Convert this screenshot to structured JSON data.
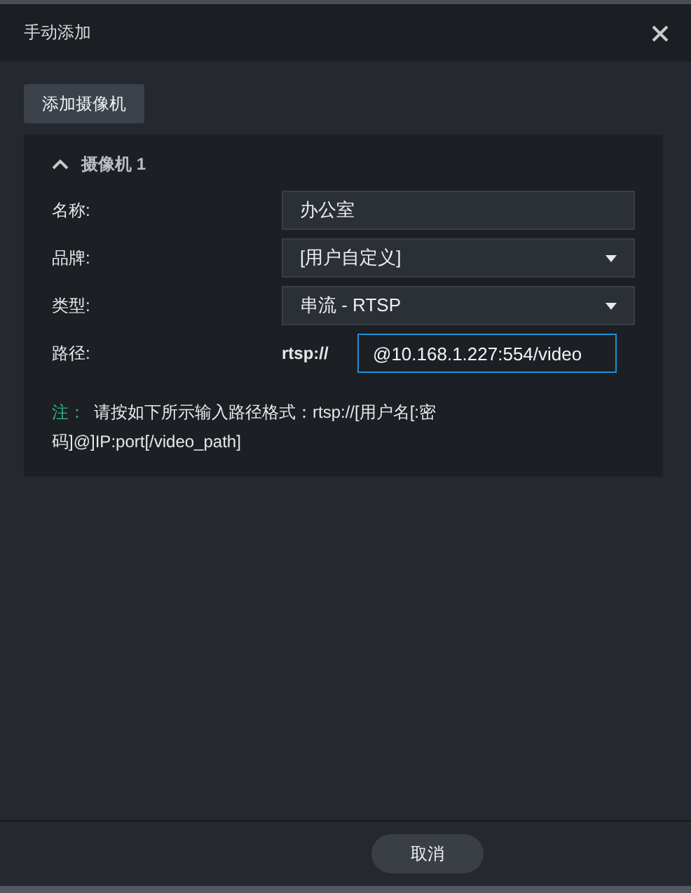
{
  "window": {
    "title": "手动添加"
  },
  "add_button": "添加摄像机",
  "camera": {
    "title": "摄像机 1",
    "expanded": true,
    "fields": [
      {
        "kind": "text",
        "label": "名称:",
        "value": "办公室"
      },
      {
        "kind": "select",
        "label": "品牌:",
        "value": "[用户自定义]"
      },
      {
        "kind": "select",
        "label": "类型:",
        "value": "串流 - RTSP"
      },
      {
        "kind": "path",
        "label": "路径:",
        "prefix": "rtsp://",
        "value": "@10.168.1.227:554/video",
        "focused": true
      }
    ],
    "note_label": "注：",
    "note_text": "请按如下所示输入路径格式：rtsp://[用户名[:密码]@]IP:port[/video_path]"
  },
  "footer_buttons": [
    "取消"
  ]
}
